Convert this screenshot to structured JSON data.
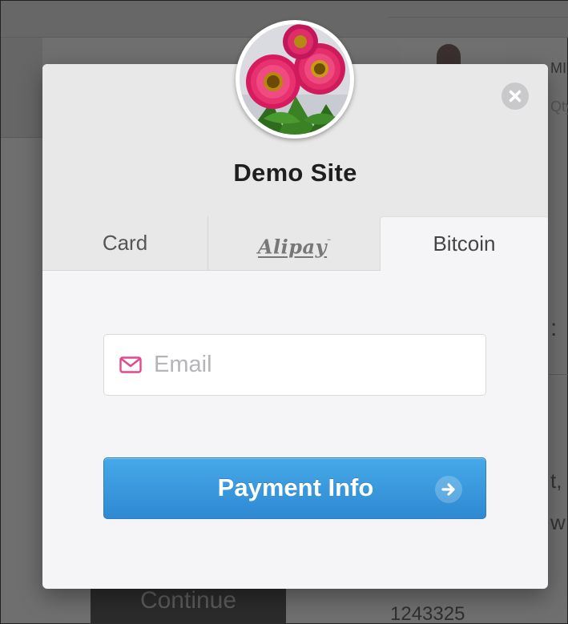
{
  "background": {
    "product_name": "MI",
    "qty": "Qty",
    "colon": ":",
    "t_comma": "t,",
    "w": "w",
    "continue_label": "Continue",
    "reference": "1243325"
  },
  "modal": {
    "site_title": "Demo Site",
    "avatar_icon": "flower-logo-icon",
    "close_icon": "close-icon",
    "tabs": [
      {
        "label": "Card",
        "active": false
      },
      {
        "label": "Alipay",
        "active": false
      },
      {
        "label": "Bitcoin",
        "active": true
      }
    ],
    "email": {
      "placeholder": "Email",
      "value": "",
      "icon": "mail-icon"
    },
    "pay_button": {
      "label": "Payment Info",
      "icon": "arrow-right-icon"
    }
  },
  "colors": {
    "accent_blue": "#3398dc",
    "mail_icon_pink": "#e3478c",
    "overlay": "#6f6f6f"
  }
}
